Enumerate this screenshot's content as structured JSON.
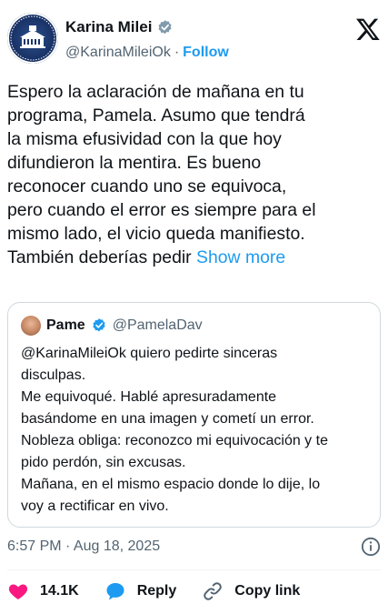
{
  "author": {
    "display_name": "Karina Milei",
    "handle": "@KarinaMileiOk",
    "separator": "·",
    "follow_label": "Follow"
  },
  "tweet": {
    "lines": [
      "Espero la aclaración de mañana en tu",
      "programa, Pamela. Asumo que tendrá",
      "la misma efusividad con la que hoy",
      "difundieron la mentira. Es bueno",
      "reconocer cuando uno se equivoca,",
      "pero cuando el error es siempre para el",
      "mismo lado, el vicio queda manifiesto.",
      "También deberías pedir"
    ],
    "show_more_label": "Show more"
  },
  "quote": {
    "display_name": "Pame",
    "handle": "@PamelaDav",
    "lines": [
      "@KarinaMileiOk quiero pedirte sinceras",
      "disculpas.",
      "Me equivoqué. Hablé apresuradamente",
      "basándome en una imagen y cometí un error.",
      "Nobleza obliga: reconozco mi equivocación y te",
      "pido perdón, sin excusas.",
      "Mañana, en el mismo espacio donde lo dije, lo",
      "voy a rectificar en vivo."
    ]
  },
  "meta": {
    "timestamp": "6:57 PM · Aug 18, 2025"
  },
  "actions": {
    "like_count": "14.1K",
    "reply_label": "Reply",
    "copy_link_label": "Copy link"
  },
  "colors": {
    "accent": "#1d9bf0",
    "like": "#f91880",
    "text": "#0f1419",
    "muted": "#536471"
  },
  "icons": {
    "verified": "verified-badge-icon",
    "x_logo": "x-logo-icon",
    "info": "info-icon",
    "like": "heart-icon",
    "reply": "speech-bubble-icon",
    "copy_link": "link-icon"
  }
}
